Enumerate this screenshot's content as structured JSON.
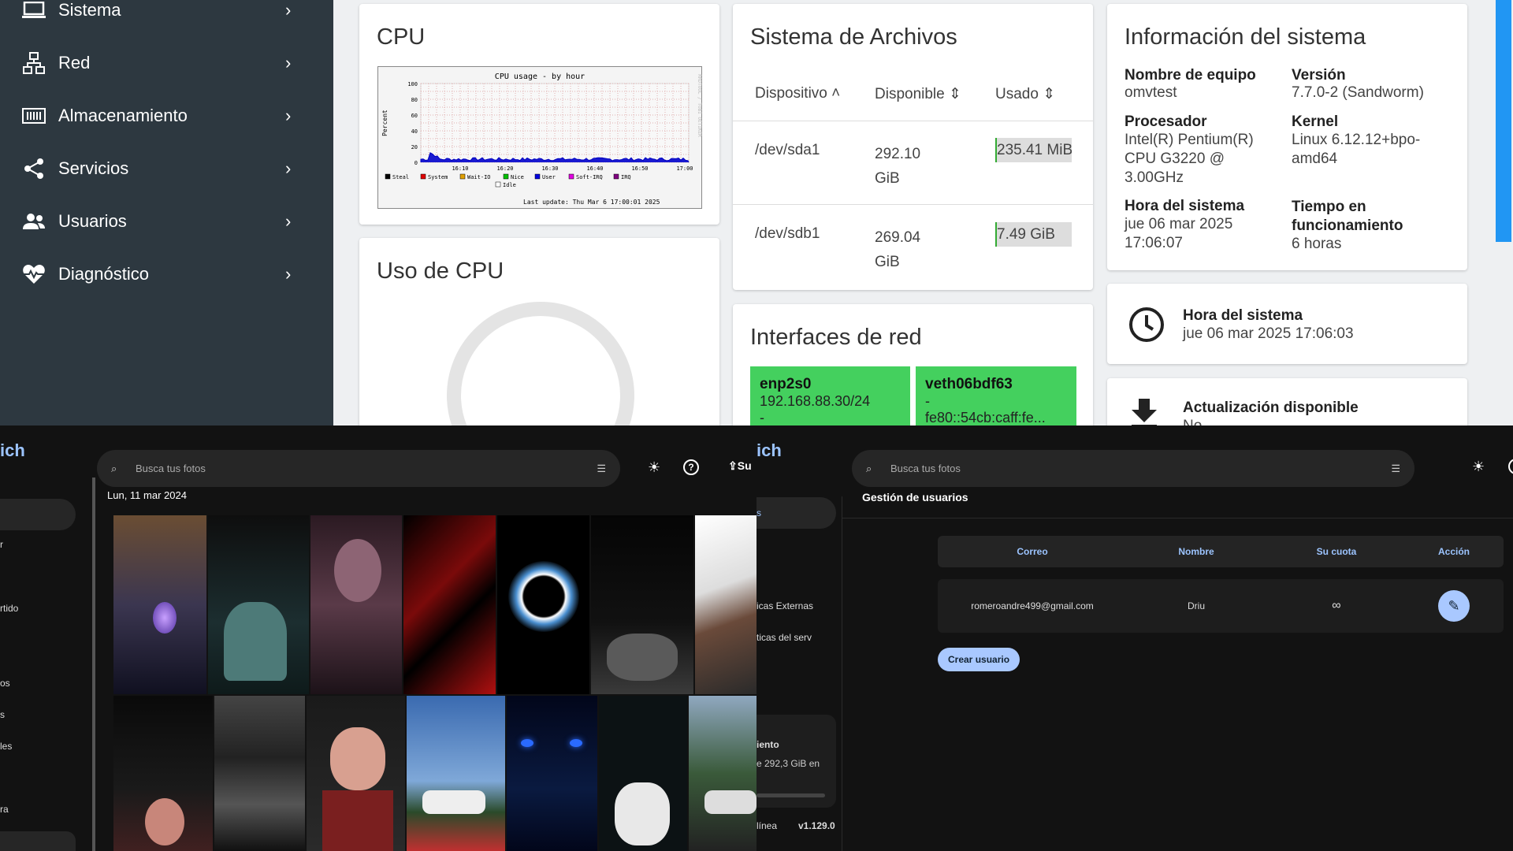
{
  "sidebar": {
    "items": [
      {
        "label": "Sistema",
        "icon": "laptop-icon"
      },
      {
        "label": "Red",
        "icon": "network-icon"
      },
      {
        "label": "Almacenamiento",
        "icon": "storage-icon"
      },
      {
        "label": "Servicios",
        "icon": "share-icon"
      },
      {
        "label": "Usuarios",
        "icon": "users-icon"
      },
      {
        "label": "Diagnóstico",
        "icon": "heartbeat-icon"
      }
    ]
  },
  "cpu": {
    "title": "CPU",
    "graph": {
      "title": "CPU usage - by hour",
      "ylabel": "Percent",
      "yticks": [
        "100",
        "80",
        "60",
        "40",
        "20",
        "0"
      ],
      "xticks": [
        "16:10",
        "16:20",
        "16:30",
        "16:40",
        "16:50",
        "17:00"
      ],
      "legend": [
        "Steal",
        "System",
        "Wait-IO",
        "Nice",
        "User",
        "Soft-IRQ",
        "IRQ",
        "Idle"
      ],
      "legend_colors": [
        "#000000",
        "#e00000",
        "#e0a000",
        "#00c000",
        "#0000e0",
        "#e000e0",
        "#800080",
        "#ffffff"
      ],
      "last_update": "Last update: Thu Mar  6 17:00:01 2025",
      "watermark": "RRDTOOL / TOBI OETIKER"
    }
  },
  "cpu_usage": {
    "title": "Uso de CPU"
  },
  "fs": {
    "title": "Sistema de Archivos",
    "headers": [
      "Dispositivo",
      "Disponible",
      "Usado"
    ],
    "rows": [
      {
        "device": "/dev/sda1",
        "available": "292.10 GiB",
        "used": "235.41 MiB"
      },
      {
        "device": "/dev/sdb1",
        "available": "269.04 GiB",
        "used": "7.49 GiB"
      }
    ]
  },
  "net": {
    "title": "Interfaces de red",
    "ifaces": [
      {
        "name": "enp2s0",
        "ip": "192.168.88.30/24",
        "extra": "-"
      },
      {
        "name": "veth06bdf63",
        "ip": "-",
        "extra": "fe80::54cb:caff:fe..."
      }
    ]
  },
  "sysinfo": {
    "title": "Información del sistema",
    "fields": [
      {
        "label": "Nombre de equipo",
        "value": "omvtest"
      },
      {
        "label": "Versión",
        "value": "7.7.0-2 (Sandworm)"
      },
      {
        "label": "Procesador",
        "value": "Intel(R) Pentium(R) CPU G3220 @ 3.00GHz"
      },
      {
        "label": "Kernel",
        "value": "Linux 6.12.12+bpo-amd64"
      },
      {
        "label": "Hora del sistema",
        "value": "jue 06 mar 2025 17:06:07"
      },
      {
        "label": "Tiempo en funcionamiento",
        "value": "6 horas"
      }
    ]
  },
  "clock": {
    "label": "Hora del sistema",
    "value": "jue 06 mar 2025 17:06:03"
  },
  "update": {
    "label": "Actualización disponible",
    "value": "No"
  },
  "gallery": {
    "logo": "ich",
    "search_placeholder": "Busca tus fotos",
    "upload_label": "Su",
    "date": "Lun, 11 mar 2024",
    "side_items": [
      "r",
      "rtido",
      "os",
      "s",
      "les",
      "ra"
    ]
  },
  "admin": {
    "logo": "ich",
    "search_placeholder": "Busca tus fotos",
    "title": "Gestión de usuarios",
    "side_items": [
      "s",
      "icas Externas",
      "ticas del serv"
    ],
    "storage_title": "iento",
    "storage_text": "e 292,3 GiB en",
    "status": "línea",
    "version": "v1.129.0",
    "table": {
      "headers": [
        "Correo",
        "Nombre",
        "Su cuota",
        "Acción"
      ],
      "rows": [
        {
          "email": "romeroandre499@gmail.com",
          "name": "Driu",
          "quota": "∞"
        }
      ]
    },
    "create_label": "Crear usuario"
  }
}
